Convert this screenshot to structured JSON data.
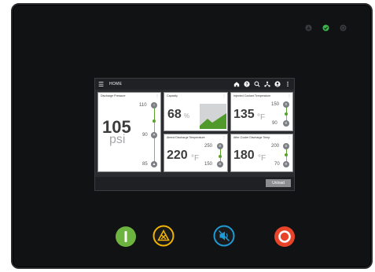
{
  "screen": {
    "title": "HOME",
    "unload_label": "Unload"
  },
  "tiles": {
    "discharge_pressure": {
      "title": "Discharge Pressure",
      "value": "105",
      "unit": "psi",
      "high": "110",
      "mid": "90",
      "low": "85"
    },
    "capacity": {
      "title": "Capacity",
      "value": "68",
      "unit": "%"
    },
    "injected_coolant": {
      "title": "Injected Coolant Temperature",
      "value": "135",
      "unit": "°F",
      "high": "150",
      "low": "90"
    },
    "airend_discharge": {
      "title": "Airend Discharge Temperature",
      "value": "220",
      "unit": "°F",
      "high": "250",
      "low": "150"
    },
    "after_cooler": {
      "title": "After-Cooler Discharge Temp.",
      "value": "180",
      "unit": "°F",
      "high": "200",
      "low": "70"
    }
  },
  "status_leds": [
    "warning-led-icon",
    "ok-check-led-icon",
    "power-led-icon"
  ],
  "hardware_buttons": [
    "start-icon",
    "reset-alarm-icon",
    "mute-icon",
    "stop-icon"
  ],
  "colors": {
    "green": "#5aa02c",
    "amber": "#f0b400",
    "blue": "#1f9ad6",
    "red": "#e8442a"
  }
}
